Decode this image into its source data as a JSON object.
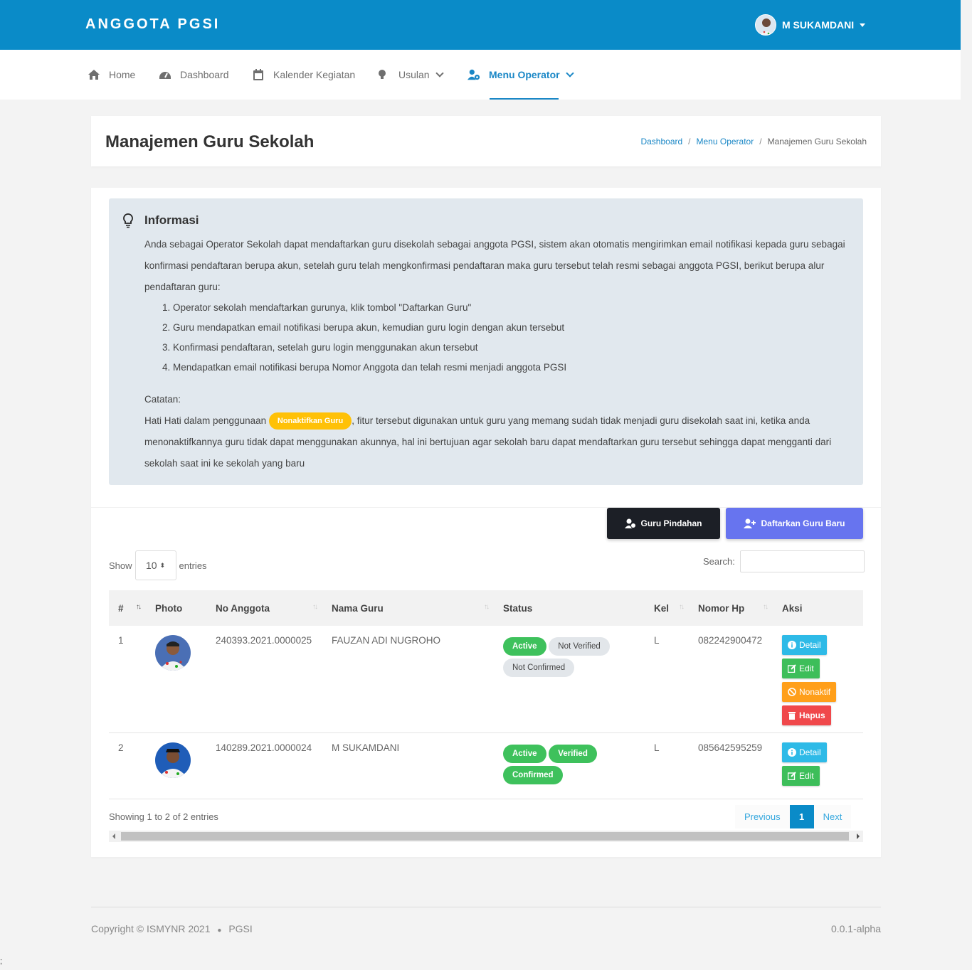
{
  "brand": "ANGGOTA PGSI",
  "user": {
    "name": "M SUKAMDANI"
  },
  "nav": [
    {
      "label": "Home",
      "icon": "home-icon"
    },
    {
      "label": "Dashboard",
      "icon": "gauge-icon"
    },
    {
      "label": "Kalender Kegiatan",
      "icon": "calendar-icon"
    },
    {
      "label": "Usulan",
      "icon": "lightbulb-icon"
    },
    {
      "label": "Menu Operator",
      "icon": "users-cog-icon"
    }
  ],
  "page": {
    "title": "Manajemen Guru Sekolah",
    "breadcrumb": [
      "Dashboard",
      "Menu Operator",
      "Manajemen Guru Sekolah"
    ]
  },
  "info": {
    "title": "Informasi",
    "paragraph": "Anda sebagai Operator Sekolah dapat mendaftarkan guru disekolah sebagai anggota PGSI, sistem akan otomatis mengirimkan email notifikasi kepada guru sebagai konfirmasi pendaftaran berupa akun, setelah guru telah mengkonfirmasi pendaftaran maka guru tersebut telah resmi sebagai anggota PGSI, berikut berupa alur pendaftaran guru:",
    "steps": [
      "Operator sekolah mendaftarkan gurunya, klik tombol \"Daftarkan Guru\"",
      "Guru mendapatkan email notifikasi berupa akun, kemudian guru login dengan akun tersebut",
      "Konfirmasi pendaftaran, setelah guru login menggunakan akun tersebut",
      "Mendapatkan email notifikasi berupa Nomor Anggota dan telah resmi menjadi anggota PGSI"
    ],
    "note_label": "Catatan:",
    "note_before": "Hati Hati dalam penggunaan",
    "note_badge": "Nonaktifkan Guru",
    "note_after": ", fitur tersebut digunakan untuk guru yang memang sudah tidak menjadi guru disekolah saat ini, ketika anda menonaktifkannya guru tidak dapat menggunakan akunnya, hal ini bertujuan agar sekolah baru dapat mendaftarkan guru tersebut sehingga dapat mengganti dari sekolah saat ini ke sekolah yang baru"
  },
  "buttons": {
    "pindahan": "Guru Pindahan",
    "daftar": "Daftarkan Guru Baru"
  },
  "table_controls": {
    "show": "Show",
    "entries_value": "10",
    "entries": "entries",
    "search": "Search:"
  },
  "table": {
    "headers": [
      "#",
      "Photo",
      "No Anggota",
      "Nama Guru",
      "Status",
      "Kel",
      "Nomor Hp",
      "Aksi"
    ],
    "rows": [
      {
        "no": "1",
        "anggota": "240393.2021.0000025",
        "nama": "FAUZAN ADI NUGROHO",
        "status": [
          "Active",
          "Not Verified",
          "Not Confirmed"
        ],
        "kel": "L",
        "hp": "082242900472",
        "aksi": [
          "Detail",
          "Edit",
          "Nonaktif",
          "Hapus"
        ]
      },
      {
        "no": "2",
        "anggota": "140289.2021.0000024",
        "nama": "M SUKAMDANI",
        "status": [
          "Active",
          "Verified",
          "Confirmed"
        ],
        "kel": "L",
        "hp": "085642595259",
        "aksi": [
          "Detail",
          "Edit"
        ]
      }
    ]
  },
  "pagination": {
    "info": "Showing 1 to 2 of 2 entries",
    "previous": "Previous",
    "current": "1",
    "next": "Next"
  },
  "footer": {
    "copyright": "Copyright © ISMYNR 2021",
    "brand": "PGSI",
    "version": "0.0.1-alpha"
  },
  "stray_char": ";",
  "colors": {
    "primary": "#0a8bc8",
    "accent": "#6774ef",
    "success": "#3ec15c",
    "warning": "#ffc107"
  }
}
